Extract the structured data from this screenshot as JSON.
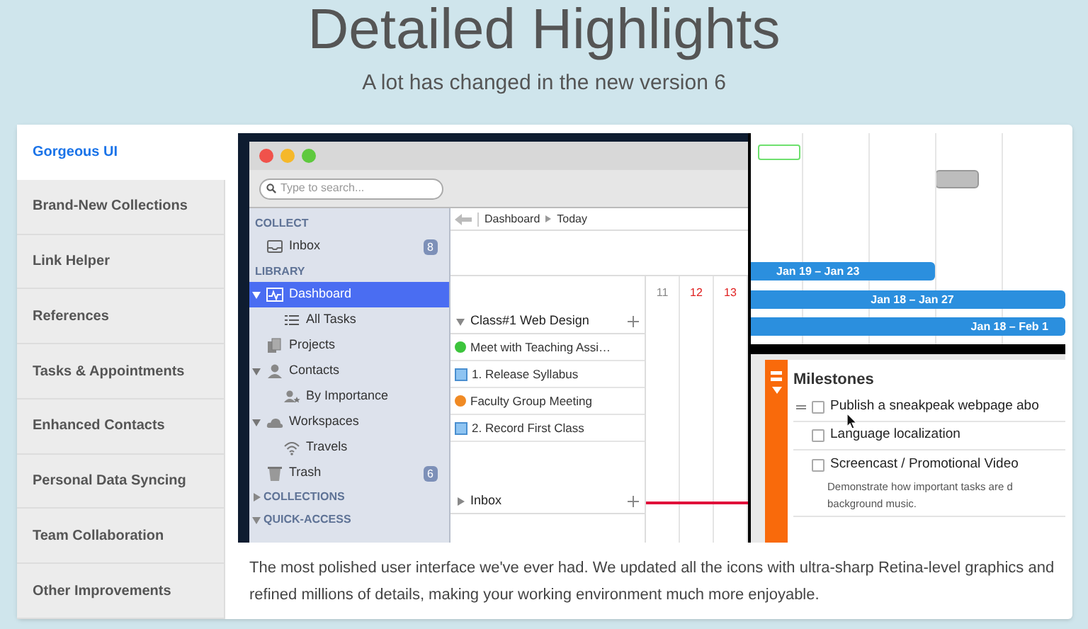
{
  "header": {
    "title": "Detailed Highlights",
    "subtitle": "A lot has changed in the new version 6"
  },
  "tabs": [
    {
      "label": "Gorgeous UI",
      "selected": true
    },
    {
      "label": "Brand-New Collections",
      "selected": false
    },
    {
      "label": "Link Helper",
      "selected": false
    },
    {
      "label": "References",
      "selected": false
    },
    {
      "label": "Tasks & Appointments",
      "selected": false
    },
    {
      "label": "Enhanced Contacts",
      "selected": false
    },
    {
      "label": "Personal Data Syncing",
      "selected": false
    },
    {
      "label": "Team Collaboration",
      "selected": false
    },
    {
      "label": "Other Improvements",
      "selected": false
    }
  ],
  "app": {
    "search": {
      "placeholder": "Type to search..."
    },
    "sidebar": [
      {
        "kind": "section",
        "label": "COLLECT",
        "children": [
          {
            "label": "Inbox",
            "badge": "8",
            "selected": false
          }
        ]
      },
      {
        "kind": "section",
        "label": "LIBRARY",
        "children": [
          {
            "label": "Dashboard",
            "selected": true,
            "expanded": true,
            "children": [
              {
                "label": "All Tasks",
                "selected": false
              }
            ]
          },
          {
            "label": "Projects",
            "selected": false
          },
          {
            "label": "Contacts",
            "selected": false,
            "expanded": true,
            "children": [
              {
                "label": "By Importance",
                "selected": false
              }
            ]
          },
          {
            "label": "Workspaces",
            "selected": false,
            "expanded": true,
            "children": [
              {
                "label": "Travels",
                "selected": false
              }
            ]
          },
          {
            "label": "Trash",
            "badge": "6",
            "selected": false
          }
        ]
      },
      {
        "kind": "collapsible",
        "label": "COLLECTIONS",
        "expanded": false
      },
      {
        "kind": "collapsible",
        "label": "QUICK-ACCESS",
        "expanded": true
      }
    ],
    "breadcrumb": [
      "Dashboard",
      "Today"
    ],
    "days": [
      {
        "label": "11",
        "weekend": false
      },
      {
        "label": "12",
        "weekend": true
      },
      {
        "label": "13",
        "weekend": true
      }
    ],
    "groups": [
      {
        "label": "Class#1 Web Design",
        "expanded": true,
        "tasks": [
          {
            "kind": "event",
            "label": "Meet with Teaching Assi…",
            "color": "#3cc43c"
          },
          {
            "kind": "task",
            "label": "1. Release Syllabus"
          },
          {
            "kind": "event",
            "label": "Faculty Group Meeting",
            "color": "#f08a24"
          },
          {
            "kind": "task",
            "label": "2. Record First Class"
          }
        ]
      },
      {
        "label": "Inbox",
        "expanded": false
      }
    ],
    "timeline_bars": [
      {
        "label": "Jan 19 – Jan 23"
      },
      {
        "label": "Jan 18 – Jan 27"
      },
      {
        "label": "Jan 18 – Feb 1"
      }
    ],
    "milestones": {
      "title": "Milestones",
      "items": [
        {
          "label": "Publish a sneakpeak webpage abo",
          "checked": false
        },
        {
          "label": "Language localization",
          "checked": false
        },
        {
          "label": "Screencast / Promotional Video",
          "checked": false,
          "note": [
            "Demonstrate how important tasks are d",
            "background music."
          ]
        }
      ]
    }
  },
  "caption": "The most polished user interface we've ever had. We updated all the icons with ultra-sharp Retina-level graphics and refined millions of details, making your working environment much more enjoyable."
}
